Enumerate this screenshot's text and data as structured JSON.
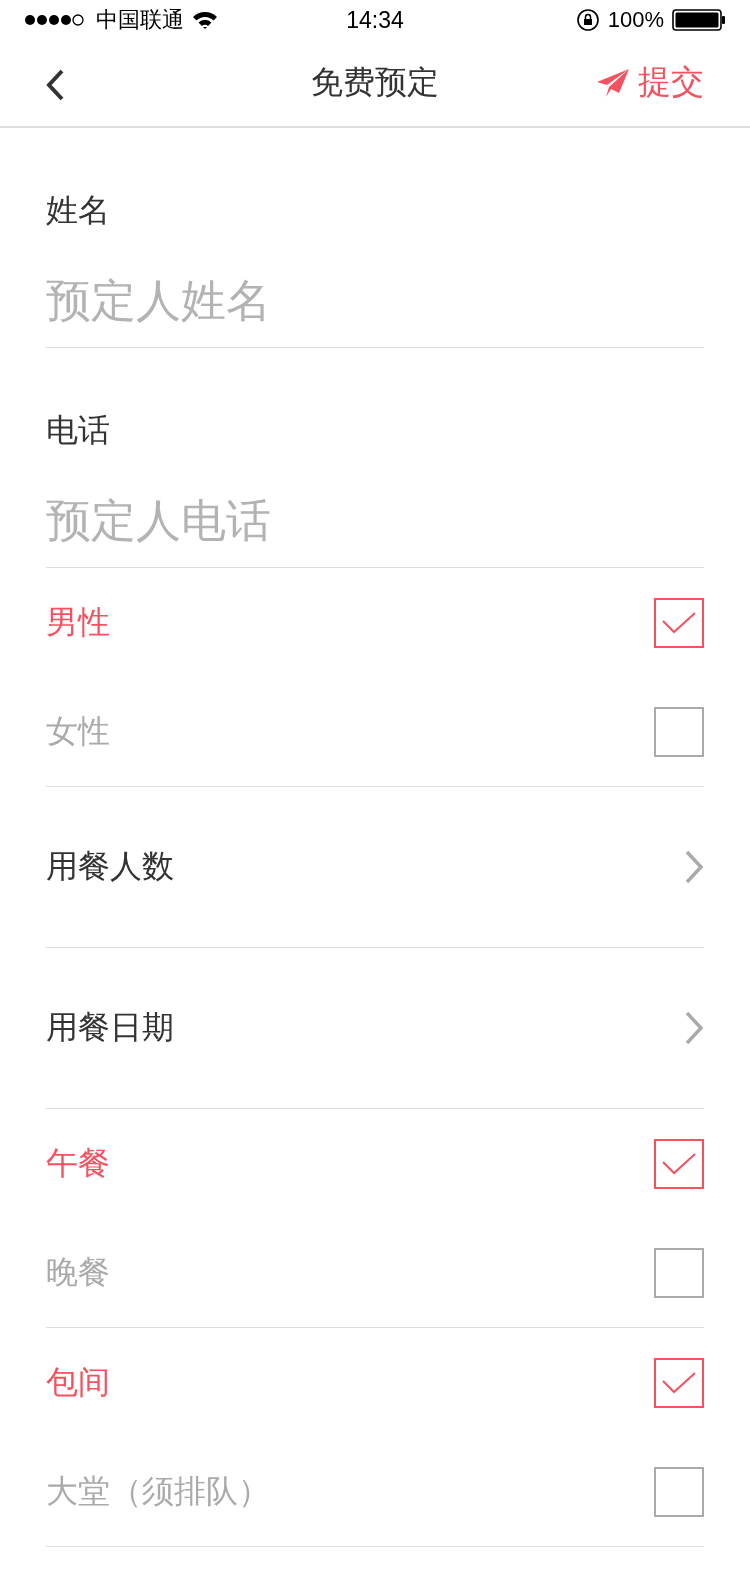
{
  "status_bar": {
    "carrier": "中国联通",
    "time": "14:34",
    "battery": "100%"
  },
  "nav_bar": {
    "title": "免费预定",
    "action": "提交"
  },
  "sections": [
    {
      "kind": "field",
      "label": "姓名",
      "placeholder": "预定人姓名"
    },
    {
      "kind": "field",
      "label": "电话",
      "placeholder": "预定人电话"
    },
    {
      "kind": "options",
      "options": [
        {
          "label": "男性",
          "checked": true
        },
        {
          "label": "女性",
          "checked": false
        }
      ]
    },
    {
      "kind": "link",
      "label": "用餐人数"
    },
    {
      "kind": "link",
      "label": "用餐日期"
    },
    {
      "kind": "options",
      "options": [
        {
          "label": "午餐",
          "checked": true
        },
        {
          "label": "晚餐",
          "checked": false
        }
      ]
    },
    {
      "kind": "options",
      "options": [
        {
          "label": "包间",
          "checked": true
        },
        {
          "label": "大堂（须排队）",
          "checked": false
        }
      ]
    }
  ]
}
